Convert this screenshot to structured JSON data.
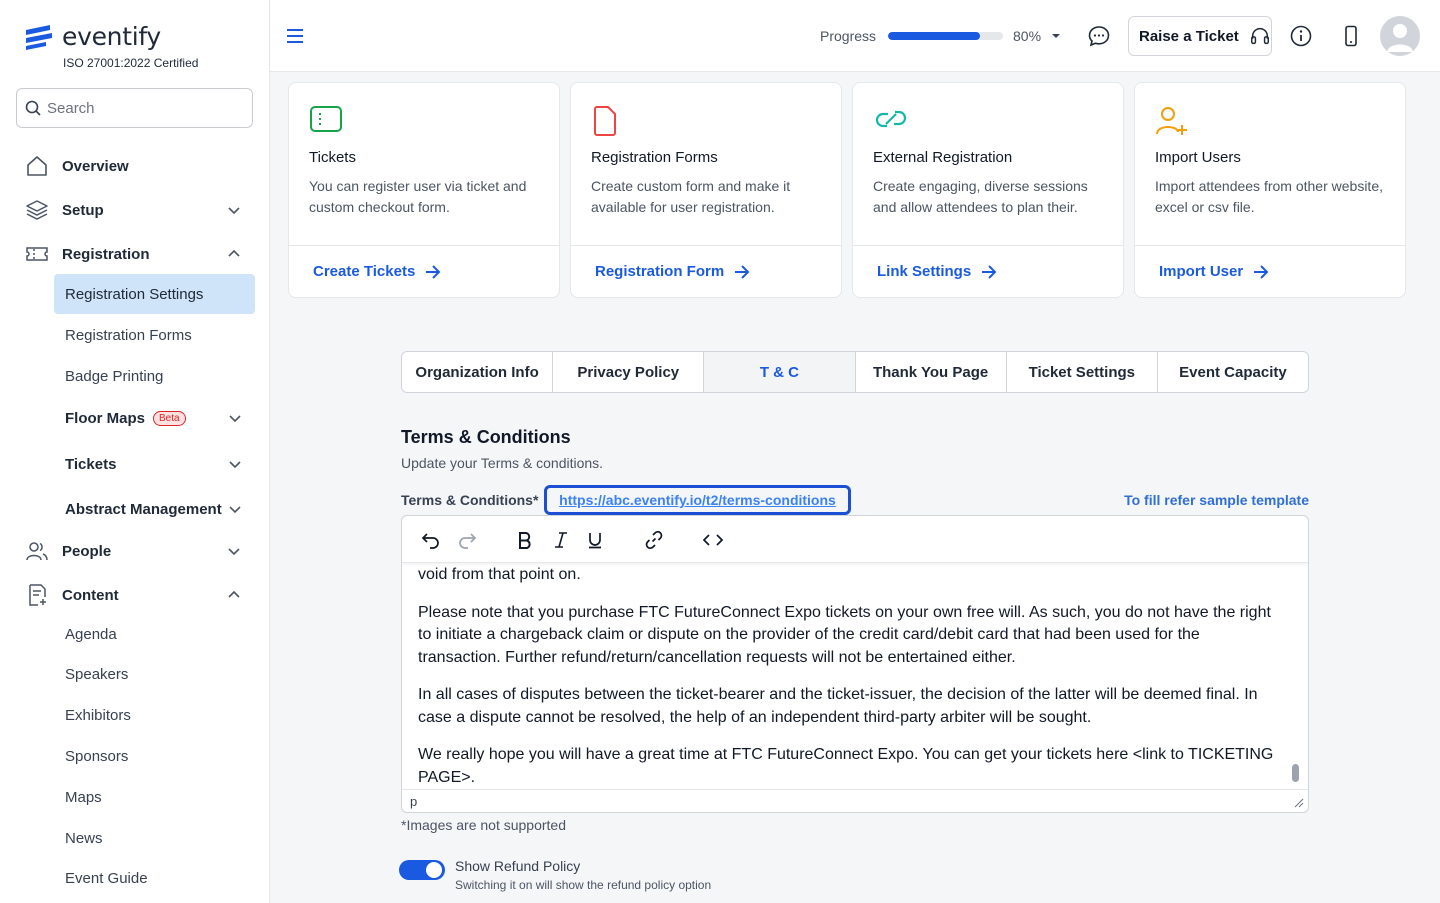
{
  "brand": {
    "name": "eventify",
    "certification": "ISO 27001:2022 Certified",
    "accent": "#1a5ae0"
  },
  "search": {
    "placeholder": "Search"
  },
  "nav": {
    "overview": "Overview",
    "setup": "Setup",
    "registration": "Registration",
    "registration_items": {
      "settings": "Registration Settings",
      "forms": "Registration Forms",
      "badge": "Badge Printing",
      "floor_maps": "Floor Maps",
      "floor_maps_badge": "Beta",
      "tickets": "Tickets",
      "abstract": "Abstract Management"
    },
    "people": "People",
    "content": "Content",
    "content_items": {
      "agenda": "Agenda",
      "speakers": "Speakers",
      "exhibitors": "Exhibitors",
      "sponsors": "Sponsors",
      "maps": "Maps",
      "news": "News",
      "event_guide": "Event Guide"
    }
  },
  "topbar": {
    "progress_label": "Progress",
    "progress_value": 80,
    "progress_text": "80%",
    "raise_ticket": "Raise a Ticket"
  },
  "cards": [
    {
      "title": "Tickets",
      "desc": "You can register user via ticket and custom checkout form.",
      "link": "Create Tickets",
      "icon": "ticket-icon",
      "color": "#16a34a"
    },
    {
      "title": "Registration Forms",
      "desc": "Create custom form and make it available for user registration.",
      "link": "Registration Form",
      "icon": "document-icon",
      "color": "#ef4444"
    },
    {
      "title": "External Registration",
      "desc": "Create engaging, diverse sessions and allow attendees to plan their.",
      "link": "Link Settings",
      "icon": "link-icon",
      "color": "#14b8a6"
    },
    {
      "title": "Import Users",
      "desc": "Import attendees from other website, excel or csv file.",
      "link": "Import User",
      "icon": "add-user-icon",
      "color": "#f59e0b"
    }
  ],
  "tabs": [
    "Organization Info",
    "Privacy Policy",
    "T & C",
    "Thank You Page",
    "Ticket Settings",
    "Event Capacity"
  ],
  "active_tab": "T & C",
  "terms": {
    "title": "Terms & Conditions",
    "subtitle": "Update your Terms & conditions.",
    "field_label": "Terms & Conditions*",
    "url": "https://abc.eventify.io/t2/terms-conditions",
    "fill_ref": "To fill refer sample template",
    "paragraphs": [
      "void from that point on.",
      "Please note that you purchase FTC FutureConnect Expo tickets on your own free will. As such, you do not have the right to initiate a chargeback claim or dispute on the provider of the credit card/debit card that had been used for the transaction. Further refund/return/cancellation requests will not be entertained either.",
      "In all cases of disputes between the ticket-bearer and the ticket-issuer, the decision of the latter will be deemed final. In case a dispute cannot be resolved, the help of an independent third-party arbiter will be sought.",
      "We really hope you will have a great time at FTC FutureConnect Expo. You can get your tickets here <link to TICKETING PAGE>."
    ],
    "status_path": "p",
    "note": "*Images are not supported"
  },
  "refund": {
    "label": "Show Refund Policy",
    "sub": "Switching it on will show the refund policy option",
    "enabled": true
  }
}
